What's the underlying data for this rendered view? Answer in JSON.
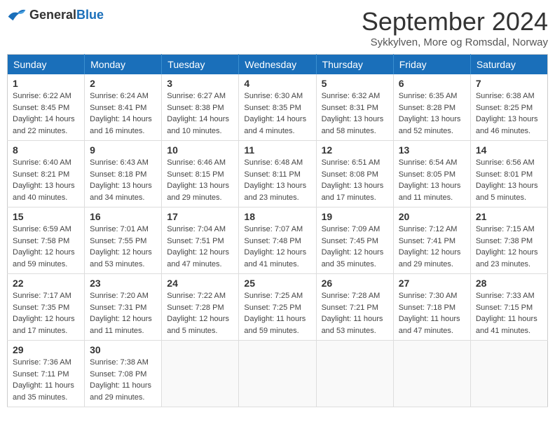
{
  "logo": {
    "general": "General",
    "blue": "Blue"
  },
  "title": "September 2024",
  "subtitle": "Sykkylven, More og Romsdal, Norway",
  "days_of_week": [
    "Sunday",
    "Monday",
    "Tuesday",
    "Wednesday",
    "Thursday",
    "Friday",
    "Saturday"
  ],
  "weeks": [
    [
      {
        "day": "1",
        "sunrise": "Sunrise: 6:22 AM",
        "sunset": "Sunset: 8:45 PM",
        "daylight": "Daylight: 14 hours and 22 minutes."
      },
      {
        "day": "2",
        "sunrise": "Sunrise: 6:24 AM",
        "sunset": "Sunset: 8:41 PM",
        "daylight": "Daylight: 14 hours and 16 minutes."
      },
      {
        "day": "3",
        "sunrise": "Sunrise: 6:27 AM",
        "sunset": "Sunset: 8:38 PM",
        "daylight": "Daylight: 14 hours and 10 minutes."
      },
      {
        "day": "4",
        "sunrise": "Sunrise: 6:30 AM",
        "sunset": "Sunset: 8:35 PM",
        "daylight": "Daylight: 14 hours and 4 minutes."
      },
      {
        "day": "5",
        "sunrise": "Sunrise: 6:32 AM",
        "sunset": "Sunset: 8:31 PM",
        "daylight": "Daylight: 13 hours and 58 minutes."
      },
      {
        "day": "6",
        "sunrise": "Sunrise: 6:35 AM",
        "sunset": "Sunset: 8:28 PM",
        "daylight": "Daylight: 13 hours and 52 minutes."
      },
      {
        "day": "7",
        "sunrise": "Sunrise: 6:38 AM",
        "sunset": "Sunset: 8:25 PM",
        "daylight": "Daylight: 13 hours and 46 minutes."
      }
    ],
    [
      {
        "day": "8",
        "sunrise": "Sunrise: 6:40 AM",
        "sunset": "Sunset: 8:21 PM",
        "daylight": "Daylight: 13 hours and 40 minutes."
      },
      {
        "day": "9",
        "sunrise": "Sunrise: 6:43 AM",
        "sunset": "Sunset: 8:18 PM",
        "daylight": "Daylight: 13 hours and 34 minutes."
      },
      {
        "day": "10",
        "sunrise": "Sunrise: 6:46 AM",
        "sunset": "Sunset: 8:15 PM",
        "daylight": "Daylight: 13 hours and 29 minutes."
      },
      {
        "day": "11",
        "sunrise": "Sunrise: 6:48 AM",
        "sunset": "Sunset: 8:11 PM",
        "daylight": "Daylight: 13 hours and 23 minutes."
      },
      {
        "day": "12",
        "sunrise": "Sunrise: 6:51 AM",
        "sunset": "Sunset: 8:08 PM",
        "daylight": "Daylight: 13 hours and 17 minutes."
      },
      {
        "day": "13",
        "sunrise": "Sunrise: 6:54 AM",
        "sunset": "Sunset: 8:05 PM",
        "daylight": "Daylight: 13 hours and 11 minutes."
      },
      {
        "day": "14",
        "sunrise": "Sunrise: 6:56 AM",
        "sunset": "Sunset: 8:01 PM",
        "daylight": "Daylight: 13 hours and 5 minutes."
      }
    ],
    [
      {
        "day": "15",
        "sunrise": "Sunrise: 6:59 AM",
        "sunset": "Sunset: 7:58 PM",
        "daylight": "Daylight: 12 hours and 59 minutes."
      },
      {
        "day": "16",
        "sunrise": "Sunrise: 7:01 AM",
        "sunset": "Sunset: 7:55 PM",
        "daylight": "Daylight: 12 hours and 53 minutes."
      },
      {
        "day": "17",
        "sunrise": "Sunrise: 7:04 AM",
        "sunset": "Sunset: 7:51 PM",
        "daylight": "Daylight: 12 hours and 47 minutes."
      },
      {
        "day": "18",
        "sunrise": "Sunrise: 7:07 AM",
        "sunset": "Sunset: 7:48 PM",
        "daylight": "Daylight: 12 hours and 41 minutes."
      },
      {
        "day": "19",
        "sunrise": "Sunrise: 7:09 AM",
        "sunset": "Sunset: 7:45 PM",
        "daylight": "Daylight: 12 hours and 35 minutes."
      },
      {
        "day": "20",
        "sunrise": "Sunrise: 7:12 AM",
        "sunset": "Sunset: 7:41 PM",
        "daylight": "Daylight: 12 hours and 29 minutes."
      },
      {
        "day": "21",
        "sunrise": "Sunrise: 7:15 AM",
        "sunset": "Sunset: 7:38 PM",
        "daylight": "Daylight: 12 hours and 23 minutes."
      }
    ],
    [
      {
        "day": "22",
        "sunrise": "Sunrise: 7:17 AM",
        "sunset": "Sunset: 7:35 PM",
        "daylight": "Daylight: 12 hours and 17 minutes."
      },
      {
        "day": "23",
        "sunrise": "Sunrise: 7:20 AM",
        "sunset": "Sunset: 7:31 PM",
        "daylight": "Daylight: 12 hours and 11 minutes."
      },
      {
        "day": "24",
        "sunrise": "Sunrise: 7:22 AM",
        "sunset": "Sunset: 7:28 PM",
        "daylight": "Daylight: 12 hours and 5 minutes."
      },
      {
        "day": "25",
        "sunrise": "Sunrise: 7:25 AM",
        "sunset": "Sunset: 7:25 PM",
        "daylight": "Daylight: 11 hours and 59 minutes."
      },
      {
        "day": "26",
        "sunrise": "Sunrise: 7:28 AM",
        "sunset": "Sunset: 7:21 PM",
        "daylight": "Daylight: 11 hours and 53 minutes."
      },
      {
        "day": "27",
        "sunrise": "Sunrise: 7:30 AM",
        "sunset": "Sunset: 7:18 PM",
        "daylight": "Daylight: 11 hours and 47 minutes."
      },
      {
        "day": "28",
        "sunrise": "Sunrise: 7:33 AM",
        "sunset": "Sunset: 7:15 PM",
        "daylight": "Daylight: 11 hours and 41 minutes."
      }
    ],
    [
      {
        "day": "29",
        "sunrise": "Sunrise: 7:36 AM",
        "sunset": "Sunset: 7:11 PM",
        "daylight": "Daylight: 11 hours and 35 minutes."
      },
      {
        "day": "30",
        "sunrise": "Sunrise: 7:38 AM",
        "sunset": "Sunset: 7:08 PM",
        "daylight": "Daylight: 11 hours and 29 minutes."
      },
      null,
      null,
      null,
      null,
      null
    ]
  ]
}
